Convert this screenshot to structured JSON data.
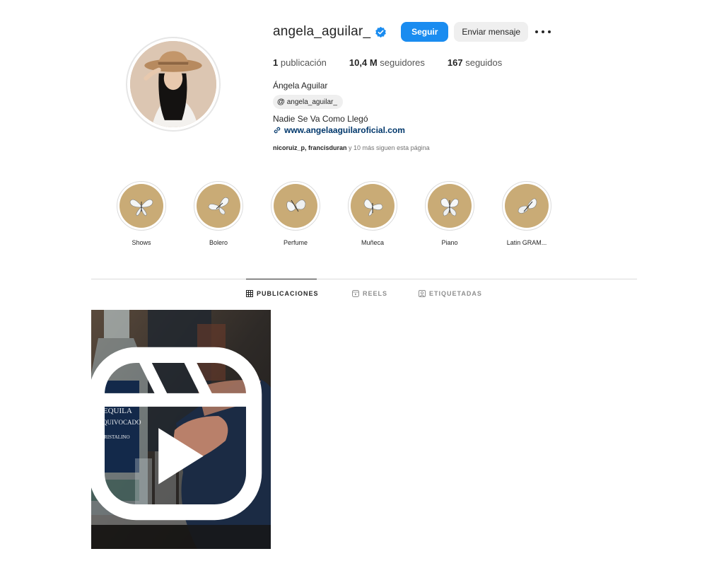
{
  "profile": {
    "username": "angela_aguilar_",
    "verified_icon": "verified-badge-icon",
    "follow_label": "Seguir",
    "message_label": "Enviar mensaje",
    "options_icon": "more-options-icon",
    "stats": {
      "posts_count": "1",
      "posts_label": "publicación",
      "followers_count": "10,4 M",
      "followers_label": "seguidores",
      "following_count": "167",
      "following_label": "seguidos"
    },
    "full_name": "Ángela Aguilar",
    "threads_handle": "angela_aguilar_",
    "bio": "Nadie Se Va Como Llegó",
    "link": "www.angelaaguilaroficial.com",
    "followed_by_names": "nicoruiz_p, francisduran",
    "followed_by_rest": " y 10 más siguen esta página"
  },
  "highlights": [
    {
      "label": "Shows"
    },
    {
      "label": "Bolero"
    },
    {
      "label": "Perfume"
    },
    {
      "label": "Muñeca"
    },
    {
      "label": "Piano"
    },
    {
      "label": "Latin GRAM..."
    }
  ],
  "tabs": {
    "posts": "PUBLICACIONES",
    "reels": "REELS",
    "tagged": "ETIQUETADAS"
  },
  "post": {
    "bottle_text_line1": "TEQUILA",
    "bottle_text_line2": "EL EQUIVOCADO",
    "bottle_text_line3": "CRISTALINO",
    "badge_icon": "reel-icon"
  },
  "colors": {
    "accent": "#1a8cf0",
    "link": "#00376b",
    "highlight_bg": "#c9ab76"
  }
}
